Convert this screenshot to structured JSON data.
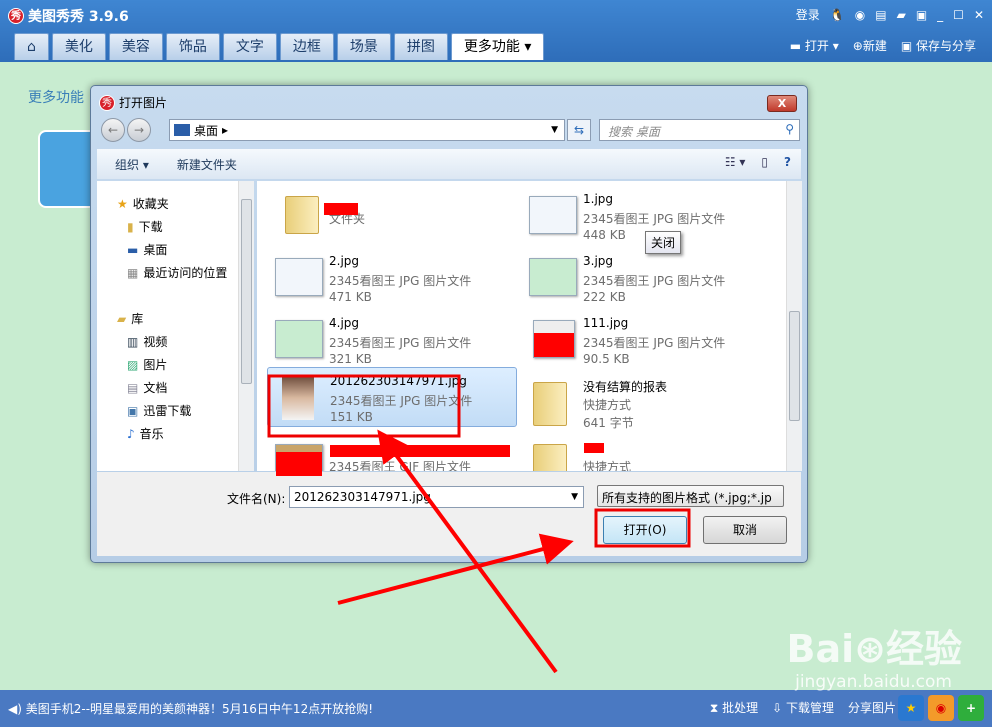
{
  "app": {
    "title": "美图秀秀 3.9.6",
    "logo_text": "秀",
    "login": "登录"
  },
  "tabs": [
    {
      "label": "美化"
    },
    {
      "label": "美容"
    },
    {
      "label": "饰品"
    },
    {
      "label": "文字"
    },
    {
      "label": "边框"
    },
    {
      "label": "场景"
    },
    {
      "label": "拼图"
    },
    {
      "label": "更多功能 ▾",
      "active": true
    }
  ],
  "actions": {
    "open": "打开",
    "new": "新建",
    "save": "保存与分享"
  },
  "panel": {
    "label": "更多功能"
  },
  "dialog": {
    "title": "打开图片",
    "close": "X",
    "address": "桌面",
    "search_placeholder": "搜索 桌面",
    "toolbar": {
      "organize": "组织 ▾",
      "new_folder": "新建文件夹"
    },
    "nav": [
      {
        "label": "收藏夹",
        "icon": "star-icon"
      },
      {
        "label": "下载",
        "icon": "download-folder-icon"
      },
      {
        "label": "桌面",
        "icon": "desktop-icon"
      },
      {
        "label": "最近访问的位置",
        "icon": "recent-icon"
      },
      {
        "label": "库",
        "icon": "library-icon"
      },
      {
        "label": "视频",
        "icon": "video-icon"
      },
      {
        "label": "图片",
        "icon": "pictures-icon"
      },
      {
        "label": "文档",
        "icon": "documents-icon"
      },
      {
        "label": "迅雷下载",
        "icon": "thunder-icon"
      },
      {
        "label": "音乐",
        "icon": "music-icon"
      }
    ],
    "files": [
      {
        "name": "",
        "type": "文件夹",
        "size": "",
        "kind": "folder"
      },
      {
        "name": "1.jpg",
        "type": "2345看图王 JPG 图片文件",
        "size": "448 KB",
        "kind": "image"
      },
      {
        "name": "2.jpg",
        "type": "2345看图王 JPG 图片文件",
        "size": "471 KB",
        "kind": "image"
      },
      {
        "name": "3.jpg",
        "type": "2345看图王 JPG 图片文件",
        "size": "222 KB",
        "kind": "image"
      },
      {
        "name": "4.jpg",
        "type": "2345看图王 JPG 图片文件",
        "size": "321 KB",
        "kind": "image"
      },
      {
        "name": "111.jpg",
        "type": "2345看图王 JPG 图片文件",
        "size": "90.5 KB",
        "kind": "image"
      },
      {
        "name": "201262303147971.jpg",
        "type": "2345看图王 JPG 图片文件",
        "size": "151 KB",
        "kind": "photo",
        "selected": true
      },
      {
        "name": "没有结算的报表",
        "type": "快捷方式",
        "size": "641 字节",
        "kind": "shortcut"
      },
      {
        "name": "",
        "type": "2345看图王 GIF 图片文件",
        "size": "",
        "kind": "image"
      },
      {
        "name": "",
        "type": "快捷方式",
        "size": "",
        "kind": "shortcut"
      }
    ],
    "tooltip": "关闭",
    "filename_label": "文件名(N):",
    "filename_value": "201262303147971.jpg",
    "filetype": "所有支持的图片格式 (*.jpg;*.jp",
    "open_button": "打开(O)",
    "cancel_button": "取消"
  },
  "statusbar": {
    "news": "美图手机2--明星最爱用的美颜神器！5月16日中午12点开放抢购!",
    "batch": "批处理",
    "downloads": "下载管理",
    "share": "分享图片"
  },
  "watermark": {
    "text": "Baidu经验",
    "url": "jingyan.baidu.com"
  },
  "colors": {
    "header": "#3f86d2",
    "background": "#c8ecd0",
    "annotation": "#ff0000"
  }
}
